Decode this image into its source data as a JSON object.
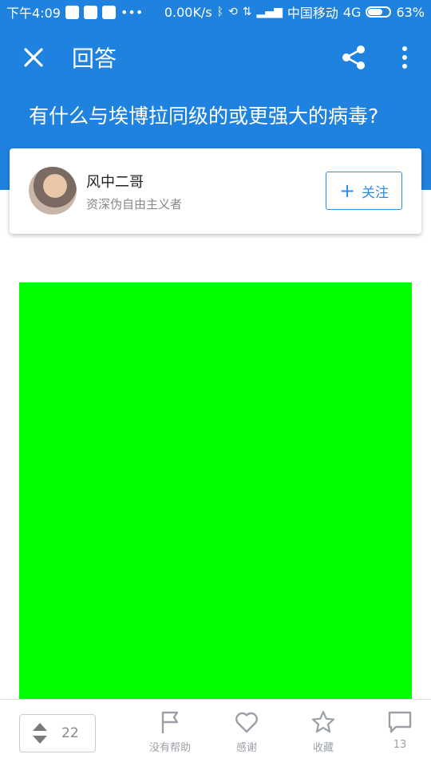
{
  "status_bar": {
    "time": "下午4:09",
    "dots": "•••",
    "speed": "0.00K/s",
    "carrier": "中国移动",
    "network": "4G",
    "battery": "63%",
    "battery_level": 0.63
  },
  "header": {
    "title": "回答",
    "question": "有什么与埃博拉同级的或更强大的病毒?",
    "icons": [
      "close-icon",
      "share-icon",
      "more-vert-icon"
    ]
  },
  "author": {
    "name": "风中二哥",
    "bio": "资深伪自由主义者",
    "follow_label": "关注"
  },
  "content": {
    "image_color": "#00ff00"
  },
  "bottom_bar": {
    "vote_count": "22",
    "actions": [
      {
        "label": "没有帮助",
        "icon": "flag-icon"
      },
      {
        "label": "感谢",
        "icon": "heart-icon"
      },
      {
        "label": "收藏",
        "icon": "star-icon"
      },
      {
        "label": "13",
        "icon": "comment-icon"
      }
    ]
  },
  "colors": {
    "primary": "#1f82df",
    "follow": "#2a8ee8",
    "icon_gray": "#9aa0a6"
  }
}
